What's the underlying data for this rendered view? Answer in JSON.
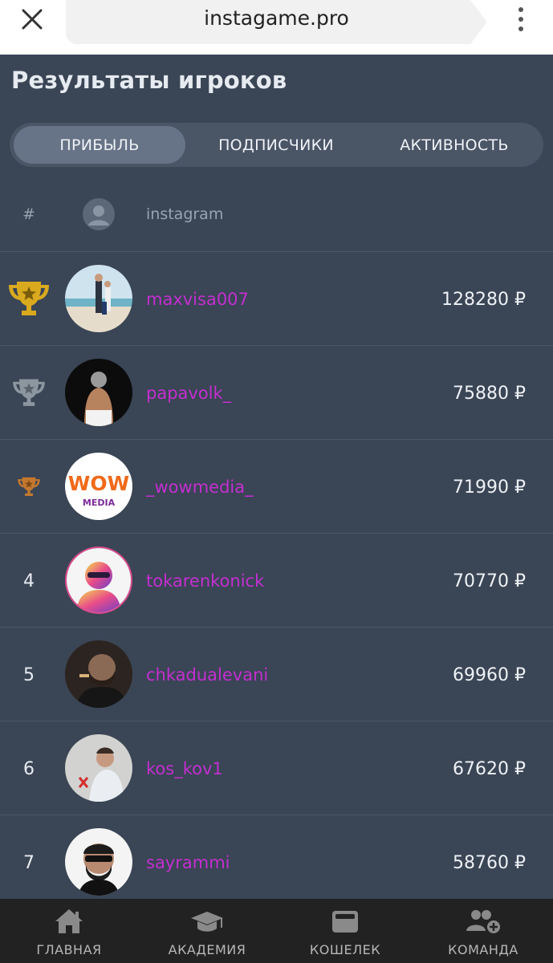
{
  "browser": {
    "url": "instagame.pro"
  },
  "page": {
    "title": "Результаты игроков"
  },
  "tabs": [
    {
      "label": "ПРИБЫЛЬ",
      "active": true
    },
    {
      "label": "ПОДПИСЧИКИ",
      "active": false
    },
    {
      "label": "АКТИВНОСТЬ",
      "active": false
    }
  ],
  "table": {
    "header": {
      "rank": "#",
      "account": "instagram"
    },
    "rows": [
      {
        "rank": "",
        "trophy": "gold",
        "username": "maxvisa007",
        "amount": "128280 ₽"
      },
      {
        "rank": "",
        "trophy": "silver",
        "username": "papavolk_",
        "amount": "75880 ₽"
      },
      {
        "rank": "",
        "trophy": "bronze",
        "username": "_wowmedia_",
        "amount": "71990 ₽"
      },
      {
        "rank": "4",
        "trophy": "",
        "username": "tokarenkonick",
        "amount": "70770 ₽"
      },
      {
        "rank": "5",
        "trophy": "",
        "username": "chkadualevani",
        "amount": "69960 ₽"
      },
      {
        "rank": "6",
        "trophy": "",
        "username": "kos_kov1",
        "amount": "67620 ₽"
      },
      {
        "rank": "7",
        "trophy": "",
        "username": "sayrammi",
        "amount": "58760 ₽"
      }
    ]
  },
  "bottom_nav": [
    {
      "label": "ГЛАВНАЯ",
      "icon": "home-icon"
    },
    {
      "label": "АКАДЕМИЯ",
      "icon": "graduation-cap-icon"
    },
    {
      "label": "КОШЕЛЕК",
      "icon": "wallet-icon"
    },
    {
      "label": "КОМАНДА",
      "icon": "add-team-icon"
    }
  ],
  "colors": {
    "background": "#3a4555",
    "username": "#c42fd0",
    "gold": "#d9a91e",
    "silver": "#8c969f",
    "bronze": "#c4782f"
  }
}
